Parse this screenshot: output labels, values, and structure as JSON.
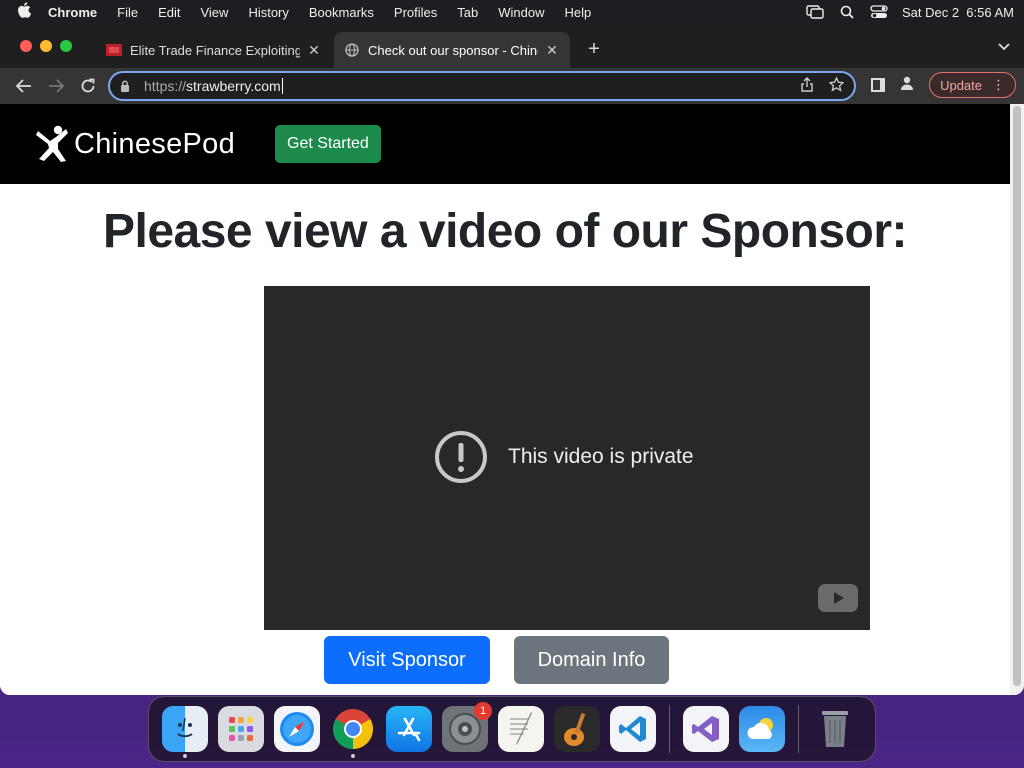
{
  "menubar": {
    "app_name": "Chrome",
    "items": [
      "File",
      "Edit",
      "View",
      "History",
      "Bookmarks",
      "Profiles",
      "Tab",
      "Window",
      "Help"
    ],
    "datetime": "Sat Dec 2  6:56 AM"
  },
  "tabs": [
    {
      "title": "Elite Trade Finance Exploiting l",
      "active": false
    },
    {
      "title": "Check out our sponsor - Chine",
      "active": true
    }
  ],
  "omnibox": {
    "scheme": "https://",
    "host": "strawberry.com"
  },
  "toolbar": {
    "update_label": "Update"
  },
  "site": {
    "logo_text": "ChinesePod",
    "get_started_label": "Get Started",
    "headline": "Please view a video of our Sponsor:",
    "video_message": "This video is private",
    "visit_sponsor_label": "Visit Sponsor",
    "domain_info_label": "Domain Info"
  },
  "dock": {
    "apps": [
      "finder",
      "launchpad",
      "safari",
      "chrome",
      "app-store",
      "system-settings",
      "textedit",
      "garageband",
      "vscode",
      "visual-studio",
      "weather",
      "trash"
    ],
    "system_settings_badge": "1"
  },
  "colors": {
    "omnibox_focus": "#7aa7f0",
    "get_started": "#1c8a4a",
    "primary_button": "#0d6efd",
    "secondary_button": "#6c757d",
    "video_bg": "#282828"
  }
}
